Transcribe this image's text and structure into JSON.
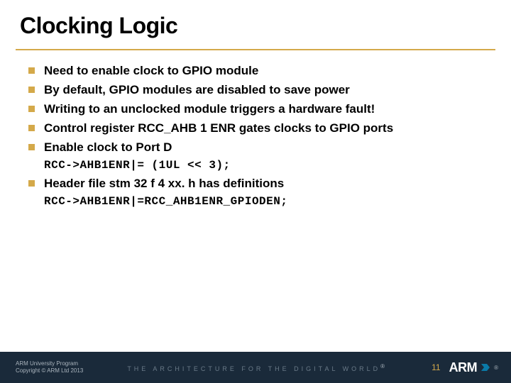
{
  "title": "Clocking Logic",
  "bullets": [
    "Need to enable clock to GPIO module",
    "By default, GPIO modules are disabled to save power",
    "Writing to an unclocked module triggers a hardware fault!",
    "Control register RCC_AHB 1 ENR gates clocks to GPIO ports",
    "Enable clock to Port D"
  ],
  "code1": "RCC->AHB1ENR|= (1UL <<  3);",
  "bullet6": "Header file stm 32 f 4 xx. h has definitions",
  "code2": "RCC->AHB1ENR|=RCC_AHB1ENR_GPIODEN;",
  "footer": {
    "line1": "ARM University Program",
    "line2": "Copyright © ARM Ltd 2013",
    "tagline": "THE ARCHITECTURE FOR THE DIGITAL WORLD",
    "page": "11",
    "logo_text": "ARM",
    "reg": "®"
  }
}
